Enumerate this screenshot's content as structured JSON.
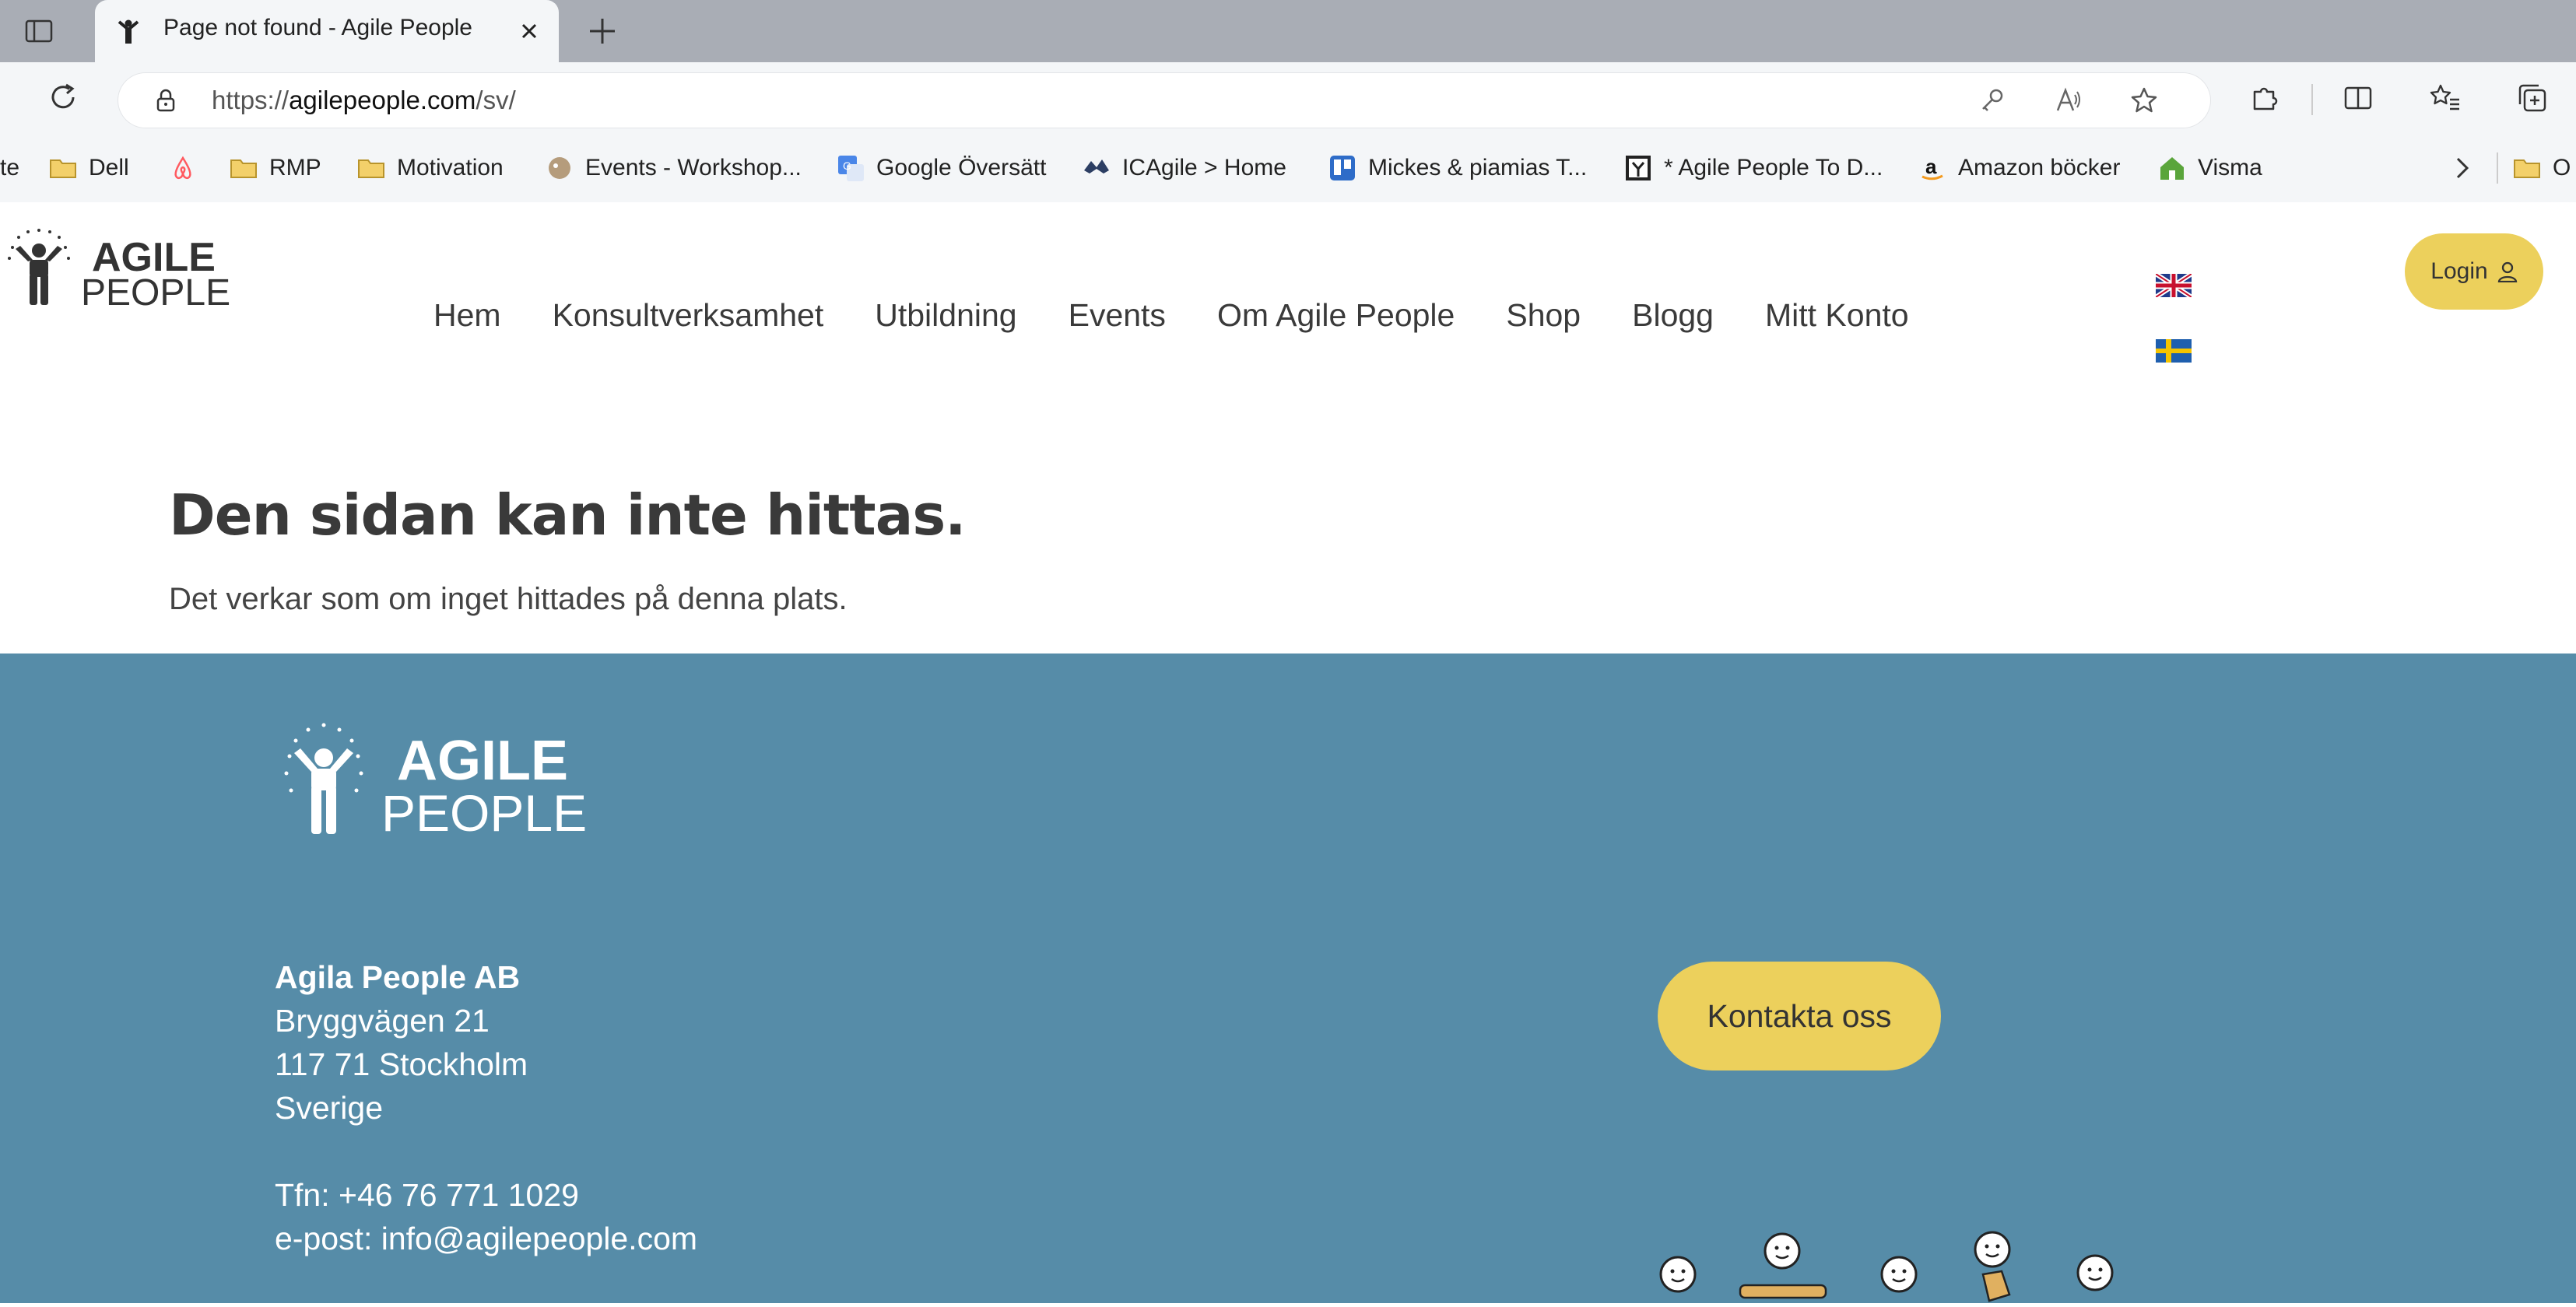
{
  "browser": {
    "tab_title": "Page not found - Agile People",
    "url_prefix": "https://",
    "url_host": "agilepeople.com",
    "url_path": "/sv/"
  },
  "bookmarks": [
    {
      "label": "te",
      "icon": "folder-icon"
    },
    {
      "label": "Dell",
      "icon": "folder-icon"
    },
    {
      "label": "",
      "icon": "airbnb-icon"
    },
    {
      "label": "RMP",
      "icon": "folder-icon"
    },
    {
      "label": "Motivation",
      "icon": "folder-icon"
    },
    {
      "label": "Events - Workshop...",
      "icon": "site-icon"
    },
    {
      "label": "Google Översätt",
      "icon": "translate-icon"
    },
    {
      "label": "ICAgile > Home",
      "icon": "site-icon"
    },
    {
      "label": "Mickes & piamias T...",
      "icon": "trello-icon"
    },
    {
      "label": "* Agile People To D...",
      "icon": "site-icon"
    },
    {
      "label": "Amazon böcker",
      "icon": "amazon-icon"
    },
    {
      "label": "Visma",
      "icon": "home-icon"
    },
    {
      "label": "O",
      "icon": "folder-icon"
    }
  ],
  "site": {
    "logo_line1": "AGILE",
    "logo_line2": "PEOPLE",
    "nav": [
      "Hem",
      "Konsultverksamhet",
      "Utbildning",
      "Events",
      "Om Agile People",
      "Shop",
      "Blogg",
      "Mitt Konto"
    ],
    "login_label": "Login",
    "heading": "Den sidan kan inte hittas.",
    "subtext": "Det verkar som om inget hittades på denna plats."
  },
  "footer": {
    "company_name": "Agila People AB",
    "street": "Bryggvägen 21",
    "city": "117 71 Stockholm",
    "country": "Sverige",
    "phone": "Tfn: +46 76 771 1029",
    "email": "e-post: info@agilepeople.com",
    "contact_label": "Kontakta oss"
  },
  "colors": {
    "footer_bg": "#568ca8",
    "accent_yellow": "#ecd05c",
    "text_dark": "#3a3a3a"
  }
}
